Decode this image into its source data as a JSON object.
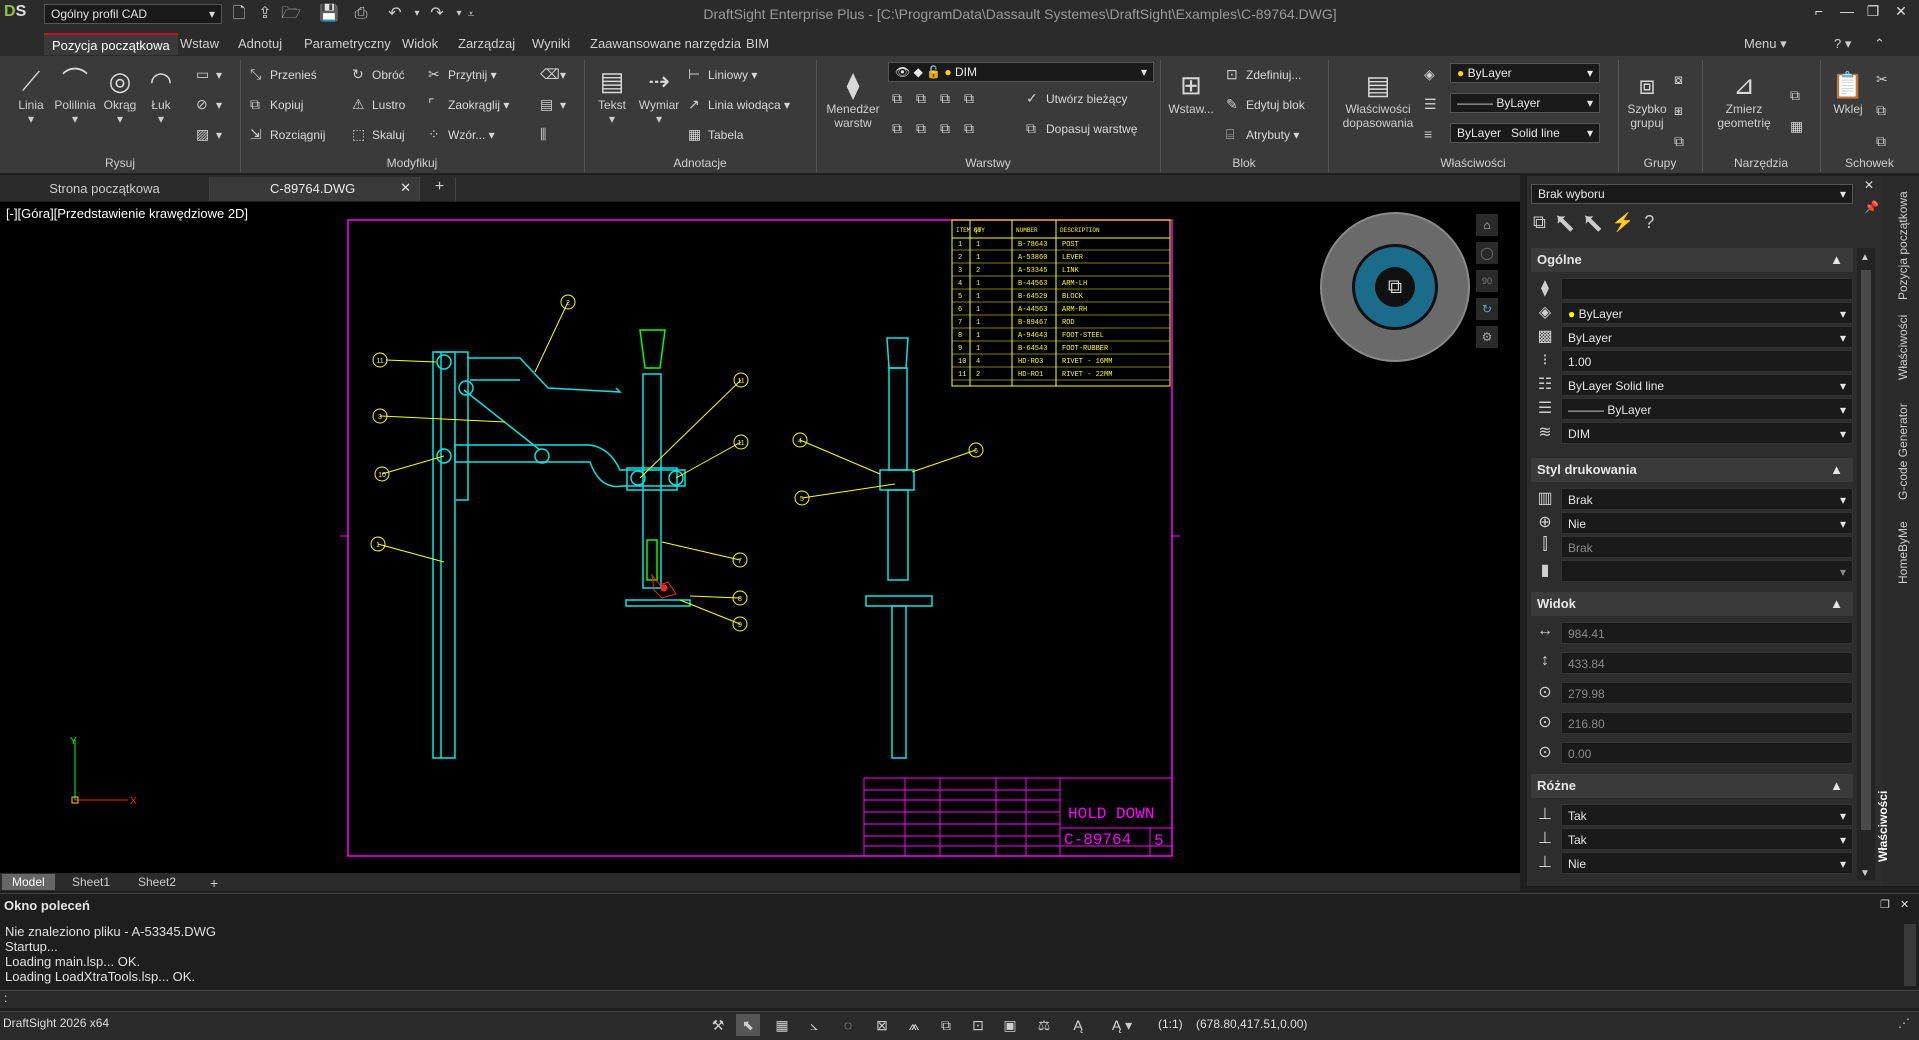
{
  "app": {
    "profile": "Ogólny profil CAD",
    "title": "DraftSight Enterprise Plus - [C:\\ProgramData\\Dassault Systemes\\DraftSight\\Examples\\C-89764.DWG]",
    "menu_label": "Menu",
    "help_label": "?",
    "version": "DraftSight 2026 x64"
  },
  "ribbon_tabs": [
    "Pozycja początkowa",
    "Wstaw",
    "Adnotuj",
    "Parametryczny",
    "Widok",
    "Zarządzaj",
    "Wyniki",
    "Zaawansowane narzędzia",
    "BIM"
  ],
  "ribbon": {
    "rysuj": {
      "label": "Rysuj",
      "linia": "Linia",
      "polilinia": "Polilinia",
      "okrag": "Okrąg",
      "luk": "Łuk"
    },
    "modyfikuj": {
      "label": "Modyfikuj",
      "przenies": "Przenieś",
      "kopiuj": "Kopiuj",
      "rozciagnij": "Rozciągnij",
      "obroc": "Obróć",
      "lustro": "Lustro",
      "skaluj": "Skaluj",
      "przytnij": "Przytnij",
      "zaokraglij": "Zaokrąglij",
      "wzor": "Wzór..."
    },
    "adnotacje": {
      "label": "Adnotacje",
      "tekst": "Tekst",
      "wymiar": "Wymiar",
      "liniowy": "Liniowy",
      "linia_wiodaca": "Linia wiodąca",
      "tabela": "Tabela"
    },
    "warstwy": {
      "label": "Warstwy",
      "menedzer": "Menedżer warstw",
      "layer_combo": "DIM",
      "utworz": "Utwórz bieżący",
      "dopasuj": "Dopasuj warstwę"
    },
    "blok": {
      "label": "Blok",
      "wstaw": "Wstaw...",
      "zdefiniuj": "Zdefiniuj...",
      "edytuj": "Edytuj blok",
      "atrybuty": "Atrybuty"
    },
    "wlasciwosci": {
      "label": "Właściwości",
      "dopasowania": "Właściwości dopasowania",
      "color": "ByLayer",
      "lineweight": "ByLayer",
      "linetype_a": "ByLayer",
      "linetype_b": "Solid line"
    },
    "grupy": {
      "label": "Grupy",
      "szybko": "Szybko grupuj"
    },
    "narzedzia": {
      "label": "Narzędzia",
      "zmierz": "Zmierz geometrię"
    },
    "schowek": {
      "label": "Schowek",
      "wklej": "Wklej"
    }
  },
  "doc_tabs": [
    "Strona początkowa",
    "C-89764.DWG"
  ],
  "view_label": "[-][Góra][Przedstawienie krawędziowe 2D]",
  "sheet_tabs": [
    "Model",
    "Sheet1",
    "Sheet2"
  ],
  "viewcube_value": "90",
  "drawing": {
    "title": "HOLD DOWN",
    "number": "C-89764",
    "rev": "5",
    "bom_headers": [
      "ITEM NO",
      "QTY",
      "NUMBER",
      "DESCRIPTION"
    ],
    "bom_rows": [
      [
        "1",
        "1",
        "B-78643",
        "POST"
      ],
      [
        "2",
        "1",
        "A-53860",
        "LEVER"
      ],
      [
        "3",
        "2",
        "A-53345",
        "LINK"
      ],
      [
        "4",
        "1",
        "B-44563",
        "ARM-LH"
      ],
      [
        "5",
        "1",
        "B-64529",
        "BLOCK"
      ],
      [
        "6",
        "1",
        "A-44563",
        "ARM-RH"
      ],
      [
        "7",
        "1",
        "B-89467",
        "ROD"
      ],
      [
        "8",
        "1",
        "A-94643",
        "FOOT-STEEL"
      ],
      [
        "9",
        "1",
        "B-64543",
        "FOOT-RUBBER"
      ],
      [
        "10",
        "4",
        "HD-RO3",
        "RIVET - 16MM"
      ],
      [
        "11",
        "2",
        "HD-RO1",
        "RIVET - 22MM"
      ]
    ],
    "balloons": [
      "11",
      "2",
      "3",
      "10",
      "1",
      "11",
      "11",
      "7",
      "8",
      "9",
      "4",
      "5",
      "6"
    ],
    "axis_y": "Y",
    "axis_x": "X"
  },
  "panel": {
    "selection": "Brak wyboru",
    "sections": {
      "ogolne": "Ogólne",
      "styl": "Styl drukowania",
      "widok": "Widok",
      "rozne": "Różne"
    },
    "ogolne_rows": [
      "",
      "ByLayer",
      "ByLayer",
      "1.00",
      "ByLayer      Solid line",
      "——— ByLayer",
      "DIM"
    ],
    "styl_rows": [
      "Brak",
      "Nie",
      "Brak",
      ""
    ],
    "widok_rows": [
      "984.41",
      "433.84",
      "279.98",
      "216.80",
      "0.00"
    ],
    "rozne_rows": [
      "Tak",
      "Tak",
      "Nie"
    ]
  },
  "side_tabs": [
    "Pozycja początkowa",
    "Właściwości",
    "G-code Generator",
    "HomeByMe",
    "Właściwości"
  ],
  "command": {
    "title": "Okno poleceń",
    "lines": [
      "Nie znaleziono pliku - A-53345.DWG",
      "Startup...",
      "Loading main.lsp...  OK.",
      "Loading LoadXtraTools.lsp...  OK."
    ],
    "prompt": ":"
  },
  "status": {
    "scale": "(1:1)",
    "coords": "(678.80,417.51,0.00)"
  },
  "colors": {
    "accent": "#c8102e",
    "cyan": "#00e5e5",
    "yellow": "#ffff00",
    "magenta": "#ff00ff",
    "green": "#00ff00",
    "red": "#ff2020"
  }
}
